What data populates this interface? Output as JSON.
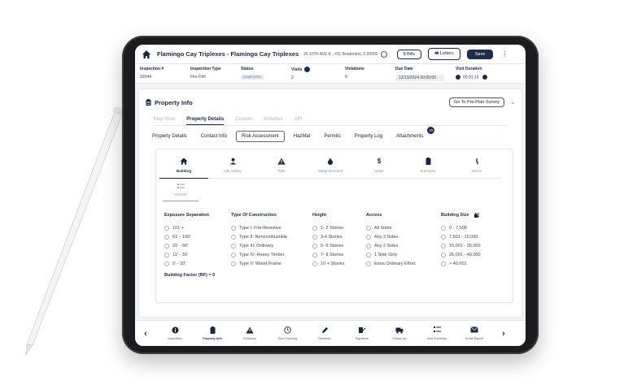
{
  "header": {
    "title": "Flamingo Cay Triplexes - Flamingo Cay Triplexes",
    "address": "26 10Th AVE E , #11 Bradenton, 0 00000",
    "bills_label": "$ Bills",
    "letters_label": "Letters",
    "save_label": "Save",
    "more_label": "⋮"
  },
  "info": {
    "inspection_no_label": "Inspection #",
    "inspection_no": "32044",
    "type_label": "Inspection Type",
    "type": "Fire Drill",
    "status_label": "Status",
    "status": "COMPLETED",
    "visits_label": "Visits",
    "visits": "2",
    "violations_label": "Violations",
    "violations": "0",
    "due_label": "Due Date",
    "due": "12/13/2024 00:00:00",
    "duration_label": "Visit Duration",
    "duration": "00:01:15"
  },
  "card": {
    "title": "Property Info",
    "go_button": "Go To Pre-Plan Survey",
    "top_tabs": [
      "Map View",
      "Property Details",
      "Custom",
      "Activities",
      "API"
    ],
    "sub_tabs": [
      "Property Details",
      "Contact Info",
      "Risk Assessment",
      "HazMat",
      "Permits",
      "Property Log",
      "Attachments"
    ],
    "attachments_count": "15"
  },
  "risk_tabs": [
    {
      "label": "Building",
      "icon": "home-icon"
    },
    {
      "label": "Life Safety",
      "icon": "person-icon"
    },
    {
      "label": "Risk",
      "icon": "warning-icon"
    },
    {
      "label": "Water Demand",
      "icon": "water-drop-icon"
    },
    {
      "label": "Value",
      "icon": "dollar-icon"
    },
    {
      "label": "Summary",
      "icon": "clipboard-icon"
    },
    {
      "label": "Heron",
      "icon": "bird-icon"
    }
  ],
  "govap_label": "GOVAP",
  "groups": [
    {
      "title": "Exposure Separation",
      "options": [
        "101 +",
        "61' - 100'",
        "31' - 60'",
        "11' - 30'",
        "0' - 10'"
      ]
    },
    {
      "title": "Type Of Construction",
      "options": [
        "Type I: Fire-Resistive",
        "Type II: Noncombustible",
        "Type III: Ordinary",
        "Type IV: Heavy Timber",
        "Type V: Wood Frame"
      ]
    },
    {
      "title": "Height",
      "options": [
        "1- 2 Stories",
        "3-4 Stories",
        "5- 6 Stories",
        "7- 9 Stories",
        "10 + Stories"
      ]
    },
    {
      "title": "Access",
      "options": [
        "All Sides",
        "Any 3 Sides",
        "Any 2 Sides",
        "1 Side Only",
        "Extra Ordinary Effort"
      ]
    },
    {
      "title": "Building Size",
      "options": [
        "0 - 7,500",
        "7,501 - 15,000",
        "15,001 - 25,000",
        "25,001 - 40,000",
        "> 40,001"
      ]
    }
  ],
  "building_factor": "Building Factor (BF) = 0",
  "bottom_nav": [
    {
      "label": "Inspection",
      "icon": "info-icon"
    },
    {
      "label": "Property Info",
      "icon": "clipboard-icon"
    },
    {
      "label": "Violations",
      "icon": "warning-icon"
    },
    {
      "label": "Time Tracking",
      "icon": "clock-icon"
    },
    {
      "label": "Remarks",
      "icon": "pencil-icon"
    },
    {
      "label": "Signature",
      "icon": "signature-icon"
    },
    {
      "label": "Follow Up",
      "icon": "truck-icon"
    },
    {
      "label": "Visit Summary",
      "icon": "list-icon"
    },
    {
      "label": "Email Report",
      "icon": "mail-icon"
    }
  ],
  "colors": {
    "primary": "#1f2d4d",
    "muted": "#b5b8be"
  }
}
